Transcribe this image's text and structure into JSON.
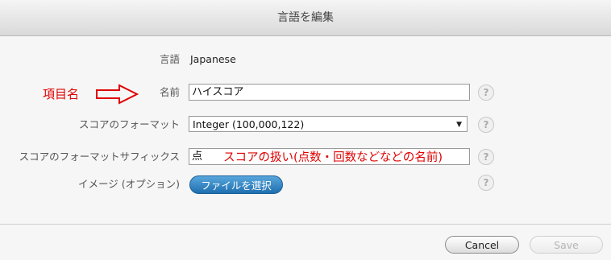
{
  "dialog": {
    "title": "言語を編集"
  },
  "form": {
    "language": {
      "label": "言語",
      "value": "Japanese"
    },
    "name": {
      "label": "名前",
      "value": "ハイスコア"
    },
    "score_format": {
      "label": "スコアのフォーマット",
      "selected": "Integer (100,000,122)"
    },
    "score_suffix": {
      "label": "スコアのフォーマットサフィックス",
      "value": "点"
    },
    "image": {
      "label": "イメージ (オプション)",
      "button_label": "ファイルを選択"
    },
    "help_glyph": "?"
  },
  "annotations": {
    "item_name": "項目名",
    "suffix_note": "スコアの扱い(点数・回数などなどの名前)",
    "color": "#e00000"
  },
  "footer": {
    "cancel_label": "Cancel",
    "save_label": "Save"
  }
}
